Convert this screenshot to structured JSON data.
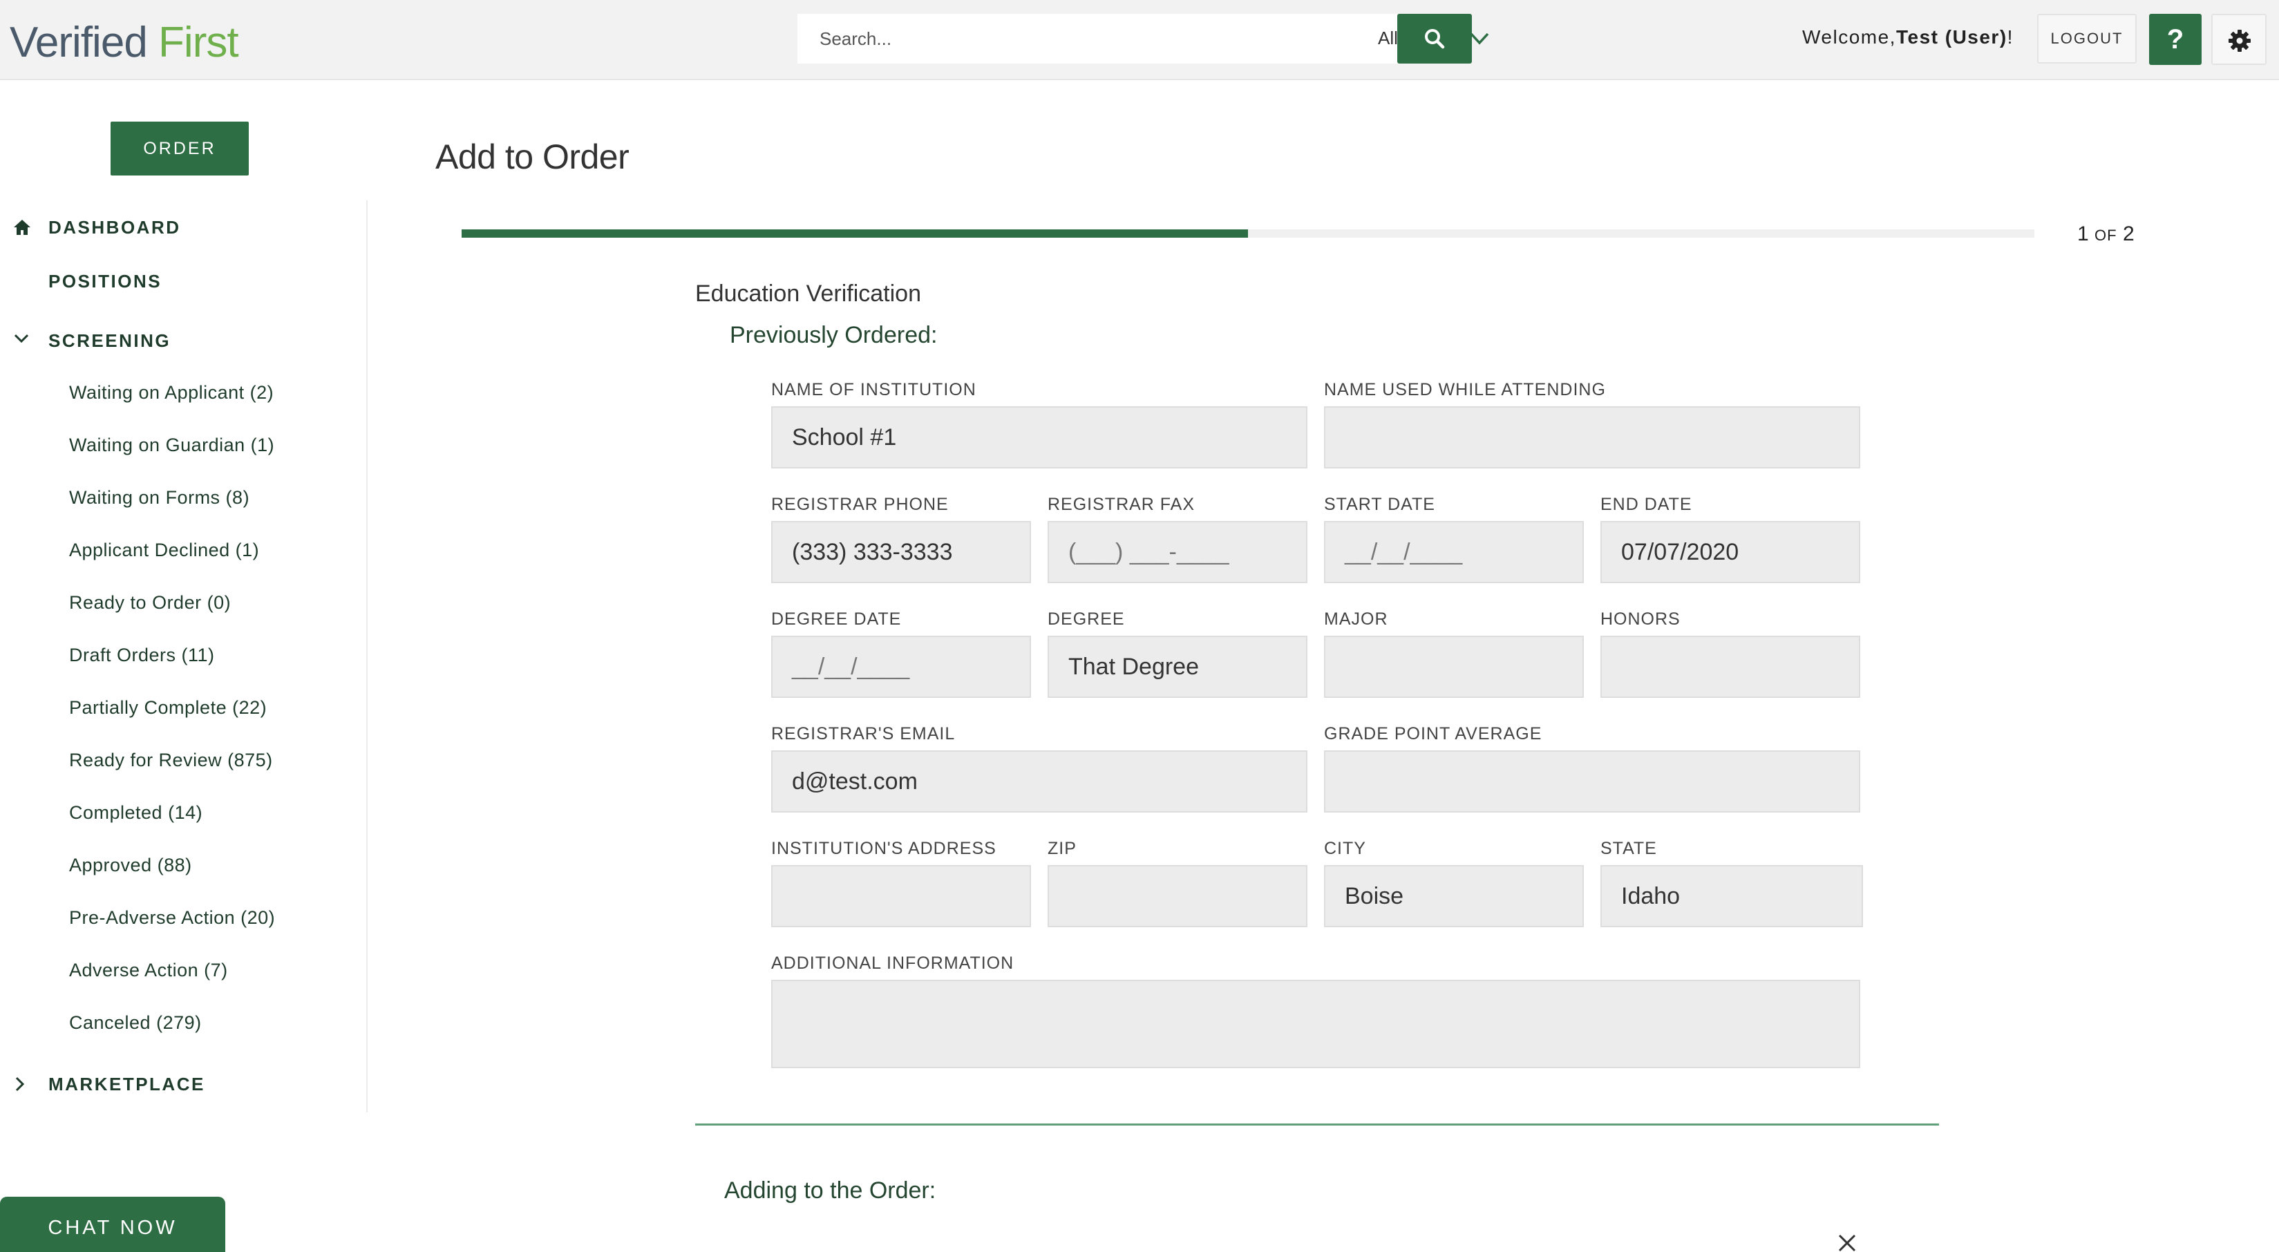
{
  "header": {
    "logo_part1": "Verified",
    "logo_part2": "First",
    "search_placeholder": "Search...",
    "search_scope": "All",
    "welcome_prefix": "Welcome,",
    "welcome_user": "Test (User)",
    "welcome_suffix": "!",
    "logout_label": "LOGOUT",
    "help_label": "?"
  },
  "sidebar": {
    "order_label": "ORDER",
    "nav": {
      "dashboard": "DASHBOARD",
      "positions": "POSITIONS",
      "screening": "SCREENING",
      "marketplace": "MARKETPLACE"
    },
    "screening_items": [
      {
        "label": "Waiting on Applicant (2)"
      },
      {
        "label": "Waiting on Guardian (1)"
      },
      {
        "label": "Waiting on Forms (8)"
      },
      {
        "label": "Applicant Declined (1)"
      },
      {
        "label": "Ready to Order (0)"
      },
      {
        "label": "Draft Orders (11)"
      },
      {
        "label": "Partially Complete (22)"
      },
      {
        "label": "Ready for Review (875)"
      },
      {
        "label": "Completed (14)"
      },
      {
        "label": "Approved (88)"
      },
      {
        "label": "Pre-Adverse Action (20)"
      },
      {
        "label": "Adverse Action (7)"
      },
      {
        "label": "Canceled (279)"
      }
    ],
    "chat_label": "CHAT NOW"
  },
  "main": {
    "title": "Add to Order",
    "progress": {
      "current": "1",
      "of": "OF",
      "total": "2",
      "fraction": 0.5
    },
    "section_title": "Education Verification",
    "previously_ordered": "Previously Ordered:",
    "adding_title": "Adding to the Order:",
    "fields": {
      "institution_name": {
        "label": "NAME OF INSTITUTION",
        "value": "School #1"
      },
      "name_used": {
        "label": "NAME USED WHILE ATTENDING",
        "value": ""
      },
      "registrar_phone": {
        "label": "REGISTRAR PHONE",
        "value": "(333) 333-3333"
      },
      "registrar_fax": {
        "label": "REGISTRAR FAX",
        "value": "(___) ___-____"
      },
      "start_date": {
        "label": "START DATE",
        "value": "__/__/____"
      },
      "end_date": {
        "label": "END DATE",
        "value": "07/07/2020"
      },
      "degree_date": {
        "label": "DEGREE DATE",
        "value": "__/__/____"
      },
      "degree": {
        "label": "DEGREE",
        "value": "That Degree"
      },
      "major": {
        "label": "MAJOR",
        "value": ""
      },
      "honors": {
        "label": "HONORS",
        "value": ""
      },
      "registrar_email": {
        "label": "REGISTRAR'S EMAIL",
        "value": "d@test.com"
      },
      "gpa": {
        "label": "GRADE POINT AVERAGE",
        "value": ""
      },
      "address": {
        "label": "INSTITUTION'S ADDRESS",
        "value": ""
      },
      "zip": {
        "label": "ZIP",
        "value": ""
      },
      "city": {
        "label": "CITY",
        "value": "Boise"
      },
      "state": {
        "label": "STATE",
        "value": "Idaho"
      },
      "additional": {
        "label": "ADDITIONAL INFORMATION",
        "value": ""
      }
    }
  },
  "colors": {
    "brand_green": "#2e6e44",
    "logo_green": "#6fb04c",
    "logo_gray": "#4a5a6a",
    "field_bg": "#ececec"
  },
  "icons": {
    "search": "search-icon",
    "chevron": "chevron-down-icon",
    "gear": "gear-icon",
    "home": "home-icon",
    "close": "close-icon"
  }
}
